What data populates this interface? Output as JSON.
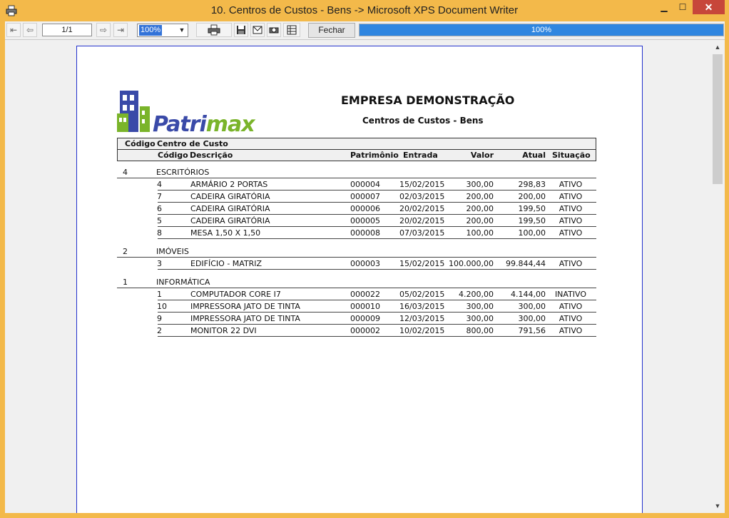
{
  "window": {
    "title": "10. Centros de Custos - Bens -> Microsoft XPS Document Writer",
    "minimize": "▁",
    "maximize": "☐",
    "close": "✕"
  },
  "toolbar": {
    "page_indicator": "1/1",
    "zoom": "100%",
    "close_label": "Fechar",
    "progress_label": "100%",
    "progress_value": 100
  },
  "report": {
    "logo_text_main": "Patri",
    "logo_text_accent": "max",
    "company": "EMPRESA DEMONSTRAÇÃO",
    "subtitle": "Centros de Custos - Bens",
    "header_row1": {
      "code": "Código",
      "cost_center": "Centro de Custo"
    },
    "header_row2": {
      "code": "Código",
      "description": "Descrição",
      "asset": "Patrimônio",
      "entry": "Entrada",
      "value": "Valor",
      "current": "Atual",
      "status": "Situação"
    },
    "groups": [
      {
        "code": "4",
        "name": "ESCRITÓRIOS",
        "items": [
          {
            "code": "4",
            "description": "ARMÁRIO 2 PORTAS",
            "asset": "000004",
            "entry": "15/02/2015",
            "value": "300,00",
            "current": "298,83",
            "status": "ATIVO"
          },
          {
            "code": "7",
            "description": "CADEIRA GIRATÓRIA",
            "asset": "000007",
            "entry": "02/03/2015",
            "value": "200,00",
            "current": "200,00",
            "status": "ATIVO"
          },
          {
            "code": "6",
            "description": "CADEIRA GIRATÓRIA",
            "asset": "000006",
            "entry": "20/02/2015",
            "value": "200,00",
            "current": "199,50",
            "status": "ATIVO"
          },
          {
            "code": "5",
            "description": "CADEIRA GIRATÓRIA",
            "asset": "000005",
            "entry": "20/02/2015",
            "value": "200,00",
            "current": "199,50",
            "status": "ATIVO"
          },
          {
            "code": "8",
            "description": "MESA 1,50 X 1,50",
            "asset": "000008",
            "entry": "07/03/2015",
            "value": "100,00",
            "current": "100,00",
            "status": "ATIVO"
          }
        ]
      },
      {
        "code": "2",
        "name": "IMÓVEIS",
        "items": [
          {
            "code": "3",
            "description": "EDIFÍCIO - MATRIZ",
            "asset": "000003",
            "entry": "15/02/2015",
            "value": "100.000,00",
            "current": "99.844,44",
            "status": "ATIVO"
          }
        ]
      },
      {
        "code": "1",
        "name": "INFORMÁTICA",
        "items": [
          {
            "code": "1",
            "description": "COMPUTADOR CORE I7",
            "asset": "000022",
            "entry": "05/02/2015",
            "value": "4.200,00",
            "current": "4.144,00",
            "status": "INATIVO"
          },
          {
            "code": "10",
            "description": "IMPRESSORA JATO DE TINTA",
            "asset": "000010",
            "entry": "16/03/2015",
            "value": "300,00",
            "current": "300,00",
            "status": "ATIVO"
          },
          {
            "code": "9",
            "description": "IMPRESSORA JATO DE TINTA",
            "asset": "000009",
            "entry": "12/03/2015",
            "value": "300,00",
            "current": "300,00",
            "status": "ATIVO"
          },
          {
            "code": "2",
            "description": "MONITOR 22 DVI",
            "asset": "000002",
            "entry": "10/02/2015",
            "value": "800,00",
            "current": "791,56",
            "status": "ATIVO"
          }
        ]
      }
    ]
  },
  "colors": {
    "window_frame": "#f3b94a",
    "progress": "#2f86e0",
    "page_border": "#2230cc",
    "logo_blue": "#3a4aa8",
    "logo_green": "#7ab42a"
  }
}
